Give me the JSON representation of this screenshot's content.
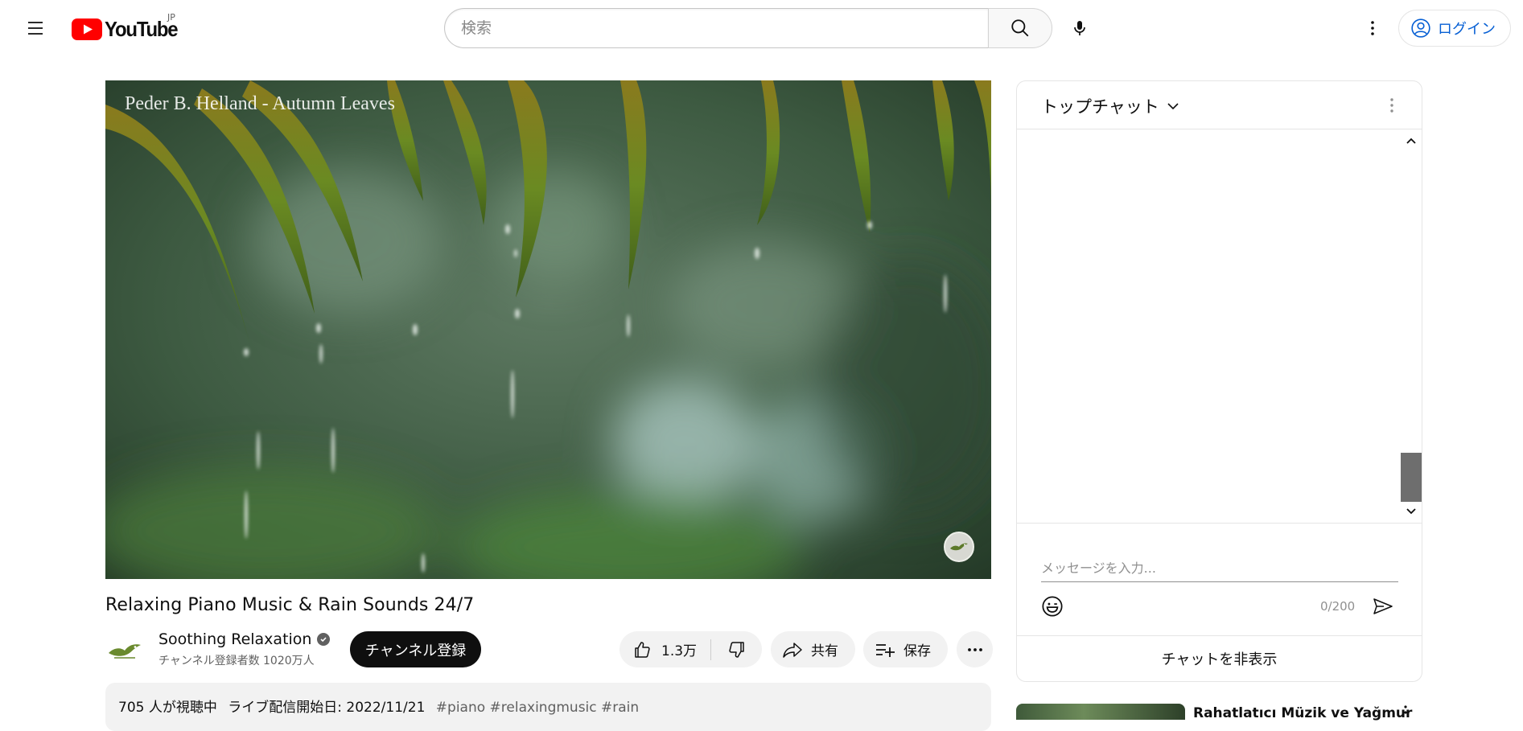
{
  "masthead": {
    "logo_text": "YouTube",
    "region_code": "JP",
    "search_placeholder": "検索",
    "login_label": "ログイン"
  },
  "player": {
    "overlay_title": "Peder B. Helland - Autumn Leaves"
  },
  "video": {
    "title": "Relaxing Piano Music & Rain Sounds 24/7",
    "channel_name": "Soothing Relaxation",
    "subscriber_count": "チャンネル登録者数 1020万人",
    "subscribe_label": "チャンネル登録",
    "like_count": "1.3万",
    "share_label": "共有",
    "save_label": "保存"
  },
  "description": {
    "viewers": "705 人が視聴中",
    "started": "ライブ配信開始日: 2022/11/21",
    "hashtags": "#piano #relaxingmusic #rain"
  },
  "chat": {
    "title": "トップチャット",
    "message_placeholder": "メッセージを入力...",
    "char_count": "0/200",
    "hide_label": "チャットを非表示"
  },
  "related": {
    "first_title": "Rahatlatıcı Müzik ve Yağmur"
  },
  "colors": {
    "brand_red": "#ff0000",
    "link_blue": "#065fd4",
    "subscribe_bg": "#0f0f0f",
    "pill_bg": "#f2f2f2"
  },
  "icons": [
    "menu-icon",
    "youtube-logo-icon",
    "search-icon",
    "mic-icon",
    "more-vert-icon",
    "account-icon",
    "verified-icon",
    "like-icon",
    "dislike-icon",
    "share-icon",
    "save-playlist-icon",
    "more-horiz-icon",
    "chevron-down-icon",
    "chevron-up-icon",
    "emoji-icon",
    "send-icon"
  ]
}
